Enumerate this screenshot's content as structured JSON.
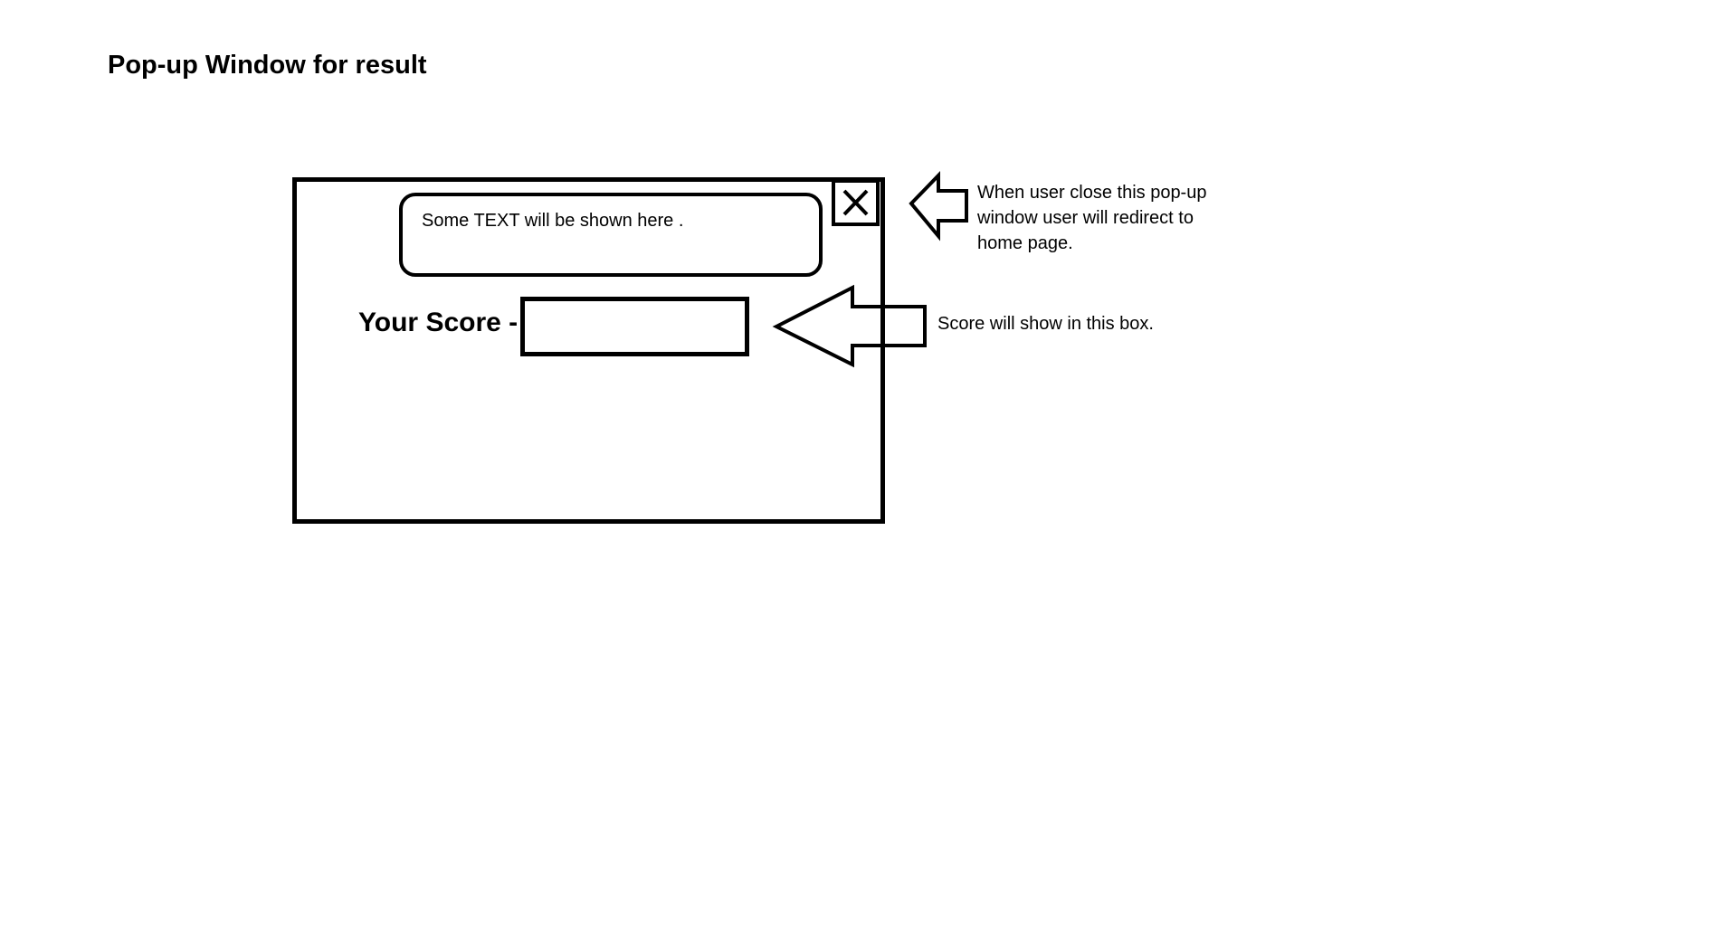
{
  "page": {
    "title": "Pop-up Window for result"
  },
  "popup": {
    "message_text": "Some TEXT will be shown here .",
    "close_icon": "close-x-icon",
    "score_label": "Your Score -",
    "score_value": ""
  },
  "annotations": {
    "close_note": "When user close this pop-up window user will redirect to home page.",
    "score_note": "Score will show in this box."
  },
  "colors": {
    "stroke": "#000000",
    "background": "#ffffff"
  }
}
